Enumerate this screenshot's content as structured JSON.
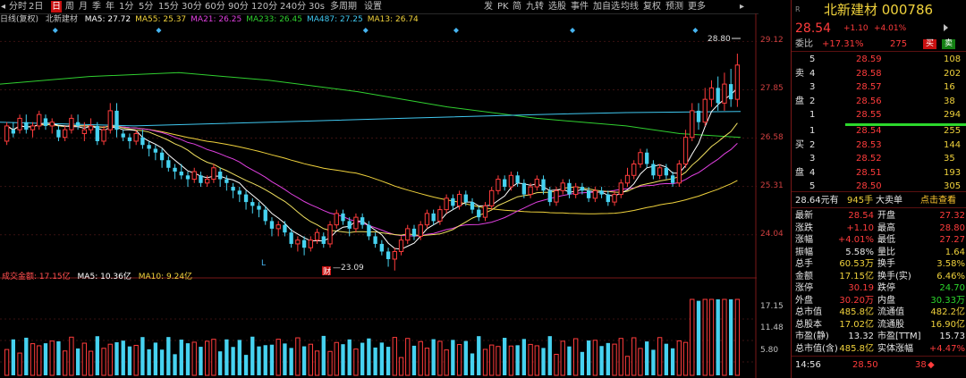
{
  "toolbar": {
    "left_items": [
      {
        "label": "分时",
        "active": false
      },
      {
        "label": "2日",
        "active": false
      },
      {
        "label": "日",
        "active": true
      },
      {
        "label": "周",
        "active": false
      },
      {
        "label": "月",
        "active": false
      },
      {
        "label": "季",
        "active": false
      },
      {
        "label": "年",
        "active": false
      },
      {
        "label": "1分",
        "active": false
      },
      {
        "label": "5分",
        "active": false
      },
      {
        "label": "15分",
        "active": false
      },
      {
        "label": "30分",
        "active": false
      },
      {
        "label": "60分",
        "active": false
      },
      {
        "label": "90分",
        "active": false
      },
      {
        "label": "120分",
        "active": false
      },
      {
        "label": "240分",
        "active": false
      },
      {
        "label": "30s",
        "active": false
      },
      {
        "label": "多周期",
        "active": false
      },
      {
        "label": "设置",
        "active": false
      }
    ],
    "right_items": [
      "发",
      "PK",
      "简",
      "九转",
      "选股",
      "事件",
      "加自选",
      "均线",
      "复权",
      "预测",
      "更多"
    ]
  },
  "ma_line": {
    "title": "日线(复权)",
    "name": "北新建材",
    "ma": [
      {
        "label": "MA5: 27.72",
        "color": "#ffffff"
      },
      {
        "label": "MA55: 25.37",
        "color": "#f0d23c"
      },
      {
        "label": "MA21: 26.25",
        "color": "#e040e0"
      },
      {
        "label": "MA233: 26.45",
        "color": "#30d030"
      },
      {
        "label": "MA487: 27.25",
        "color": "#40c8f0"
      },
      {
        "label": "MA13: 26.74",
        "color": "#f0d23c"
      }
    ]
  },
  "price_axis": [
    "29.12",
    "27.85",
    "26.58",
    "25.31",
    "24.04"
  ],
  "volume_axis": [
    "17.15",
    "11.48",
    "5.80"
  ],
  "annotations": {
    "high": "28.80",
    "low": "23.09",
    "marker_l": "L",
    "marker_cai": "财"
  },
  "volume_line": {
    "title": "成交金额: 17.15亿",
    "ma5": "MA5: 10.36亿",
    "ma10": "MA10: 9.24亿"
  },
  "chart_data": {
    "type": "candlestick",
    "ylim": [
      23.0,
      29.2
    ],
    "candles": [
      [
        26.5,
        26.9,
        26.4,
        27.0
      ],
      [
        26.8,
        26.7,
        26.6,
        27.0
      ],
      [
        26.8,
        27.1,
        26.7,
        27.2
      ],
      [
        27.0,
        26.8,
        26.7,
        27.2
      ],
      [
        26.8,
        26.9,
        26.6,
        27.0
      ],
      [
        26.9,
        27.2,
        26.8,
        27.3
      ],
      [
        27.1,
        26.9,
        26.8,
        27.2
      ],
      [
        26.9,
        27.0,
        26.7,
        27.1
      ],
      [
        26.8,
        26.6,
        26.5,
        26.9
      ],
      [
        26.6,
        26.8,
        26.5,
        26.9
      ],
      [
        26.8,
        27.1,
        26.7,
        27.2
      ],
      [
        27.0,
        26.9,
        26.8,
        27.2
      ],
      [
        26.7,
        26.8,
        26.5,
        27.0
      ],
      [
        26.8,
        26.9,
        26.7,
        27.1
      ],
      [
        26.9,
        26.5,
        26.4,
        27.0
      ],
      [
        26.5,
        26.8,
        26.4,
        26.9
      ],
      [
        26.8,
        27.3,
        26.7,
        27.5
      ],
      [
        27.3,
        26.8,
        26.6,
        27.5
      ],
      [
        26.7,
        26.6,
        26.5,
        26.8
      ],
      [
        26.6,
        26.5,
        26.3,
        26.7
      ],
      [
        26.5,
        26.7,
        26.4,
        26.8
      ],
      [
        26.6,
        26.4,
        26.3,
        26.8
      ],
      [
        26.4,
        26.3,
        26.1,
        26.5
      ],
      [
        26.3,
        26.2,
        26.0,
        26.4
      ],
      [
        26.2,
        26.0,
        25.8,
        26.3
      ],
      [
        26.0,
        25.8,
        25.7,
        26.1
      ],
      [
        25.8,
        25.7,
        25.5,
        25.9
      ],
      [
        25.7,
        25.6,
        25.5,
        25.9
      ],
      [
        25.6,
        25.5,
        25.3,
        25.7
      ],
      [
        25.5,
        25.7,
        25.4,
        25.8
      ],
      [
        25.6,
        25.4,
        25.3,
        25.7
      ],
      [
        25.4,
        25.5,
        25.3,
        25.6
      ],
      [
        25.5,
        25.8,
        25.4,
        25.9
      ],
      [
        25.7,
        25.5,
        25.3,
        25.8
      ],
      [
        25.5,
        25.4,
        25.2,
        25.6
      ],
      [
        25.3,
        25.2,
        25.0,
        25.4
      ],
      [
        25.2,
        25.1,
        24.9,
        25.3
      ],
      [
        25.1,
        24.9,
        24.7,
        25.2
      ],
      [
        24.9,
        24.8,
        24.6,
        25.0
      ],
      [
        24.8,
        24.7,
        24.5,
        24.9
      ],
      [
        24.7,
        24.4,
        24.3,
        24.8
      ],
      [
        24.4,
        24.2,
        24.0,
        24.5
      ],
      [
        24.2,
        24.3,
        24.0,
        24.4
      ],
      [
        24.3,
        24.1,
        24.0,
        24.4
      ],
      [
        24.1,
        23.8,
        23.7,
        24.2
      ],
      [
        23.8,
        23.9,
        23.6,
        24.0
      ],
      [
        23.9,
        23.7,
        23.5,
        24.0
      ],
      [
        23.7,
        23.9,
        23.6,
        24.0
      ],
      [
        23.9,
        24.1,
        23.8,
        24.2
      ],
      [
        24.0,
        23.8,
        23.7,
        24.1
      ],
      [
        23.8,
        24.3,
        23.7,
        24.4
      ],
      [
        24.3,
        24.6,
        24.2,
        24.7
      ],
      [
        24.6,
        24.4,
        24.3,
        24.7
      ],
      [
        24.4,
        24.2,
        24.0,
        24.5
      ],
      [
        24.2,
        24.5,
        24.1,
        24.6
      ],
      [
        24.5,
        24.3,
        24.2,
        24.6
      ],
      [
        24.3,
        24.0,
        23.9,
        24.4
      ],
      [
        24.0,
        23.8,
        23.7,
        24.1
      ],
      [
        23.8,
        23.6,
        23.5,
        23.9
      ],
      [
        23.6,
        23.4,
        23.2,
        23.7
      ],
      [
        23.4,
        23.6,
        23.1,
        23.7
      ],
      [
        23.6,
        23.9,
        23.5,
        24.0
      ],
      [
        23.9,
        24.2,
        23.8,
        24.3
      ],
      [
        24.2,
        24.0,
        23.9,
        24.3
      ],
      [
        24.0,
        24.3,
        23.9,
        24.4
      ],
      [
        24.3,
        24.6,
        24.2,
        24.7
      ],
      [
        24.6,
        24.4,
        24.3,
        24.7
      ],
      [
        24.4,
        24.7,
        24.3,
        24.8
      ],
      [
        24.7,
        25.0,
        24.6,
        25.1
      ],
      [
        25.0,
        24.8,
        24.7,
        25.1
      ],
      [
        24.8,
        25.1,
        24.7,
        25.2
      ],
      [
        25.1,
        24.9,
        24.8,
        25.2
      ],
      [
        24.9,
        24.7,
        24.6,
        25.0
      ],
      [
        24.7,
        24.5,
        24.4,
        24.8
      ],
      [
        24.5,
        24.8,
        24.4,
        24.9
      ],
      [
        24.8,
        25.2,
        24.7,
        25.3
      ],
      [
        25.2,
        25.5,
        25.1,
        25.6
      ],
      [
        25.5,
        25.3,
        25.2,
        25.6
      ],
      [
        25.3,
        25.6,
        25.2,
        25.7
      ],
      [
        25.6,
        25.4,
        25.3,
        25.7
      ],
      [
        25.4,
        25.1,
        25.0,
        25.5
      ],
      [
        25.1,
        25.3,
        25.0,
        25.4
      ],
      [
        25.3,
        25.5,
        25.2,
        25.6
      ],
      [
        25.5,
        25.2,
        25.1,
        25.6
      ],
      [
        25.2,
        24.9,
        24.8,
        25.3
      ],
      [
        24.9,
        25.2,
        24.8,
        25.3
      ],
      [
        25.2,
        25.4,
        25.1,
        25.5
      ],
      [
        25.4,
        25.1,
        25.0,
        25.5
      ],
      [
        25.1,
        25.3,
        25.0,
        25.4
      ],
      [
        25.3,
        25.2,
        25.1,
        25.4
      ],
      [
        25.2,
        25.0,
        24.9,
        25.3
      ],
      [
        25.0,
        25.2,
        24.9,
        25.3
      ],
      [
        25.2,
        25.1,
        25.0,
        25.3
      ],
      [
        25.1,
        24.9,
        24.8,
        25.2
      ],
      [
        24.9,
        25.1,
        24.8,
        25.2
      ],
      [
        25.1,
        25.4,
        25.0,
        25.5
      ],
      [
        25.4,
        25.6,
        25.3,
        25.8
      ],
      [
        25.6,
        25.9,
        25.5,
        26.0
      ],
      [
        25.9,
        26.2,
        25.8,
        26.3
      ],
      [
        26.2,
        25.9,
        25.8,
        26.3
      ],
      [
        25.9,
        25.6,
        25.5,
        26.0
      ],
      [
        25.6,
        25.8,
        25.5,
        25.9
      ],
      [
        25.8,
        25.6,
        25.5,
        25.9
      ],
      [
        25.6,
        25.4,
        25.3,
        25.7
      ],
      [
        25.4,
        25.9,
        25.3,
        26.0
      ],
      [
        25.9,
        26.6,
        25.8,
        26.8
      ],
      [
        26.6,
        27.3,
        26.5,
        27.5
      ],
      [
        27.3,
        27.0,
        26.8,
        27.5
      ],
      [
        27.0,
        27.6,
        26.9,
        27.9
      ],
      [
        27.6,
        27.9,
        27.4,
        28.1
      ],
      [
        27.9,
        27.5,
        27.3,
        28.2
      ],
      [
        27.5,
        28.0,
        27.3,
        28.3
      ],
      [
        28.0,
        27.6,
        27.4,
        28.4
      ],
      [
        27.6,
        28.5,
        27.4,
        28.8
      ]
    ]
  },
  "quote": {
    "code_name": "北新建材 000786",
    "price": "28.54",
    "change": "+1.10",
    "change_pct": "+4.01%",
    "weibi_label": "委比",
    "weibi_val": "+17.31%",
    "weicha": "275",
    "buy_btn": "买",
    "sell_btn": "卖",
    "sell_levels": [
      {
        "lv": "5",
        "price": "28.59",
        "vol": "108"
      },
      {
        "lv": "4",
        "price": "28.58",
        "vol": "202"
      },
      {
        "lv": "3",
        "price": "28.57",
        "vol": "16"
      },
      {
        "lv": "2",
        "price": "28.56",
        "vol": "38"
      },
      {
        "lv": "1",
        "price": "28.55",
        "vol": "294"
      }
    ],
    "buy_levels": [
      {
        "lv": "1",
        "price": "28.54",
        "vol": "255"
      },
      {
        "lv": "2",
        "price": "28.53",
        "vol": "144"
      },
      {
        "lv": "3",
        "price": "28.52",
        "vol": "35"
      },
      {
        "lv": "4",
        "price": "28.51",
        "vol": "193"
      },
      {
        "lv": "5",
        "price": "28.50",
        "vol": "305"
      }
    ],
    "sell_side_char1": "卖",
    "sell_side_char2": "盘",
    "buy_side_char1": "买",
    "buy_side_char2": "盘",
    "bigorder_price": "28.64元有",
    "bigorder_vol": "945手",
    "bigorder_text": "大卖单",
    "bigorder_link": "点击查看",
    "stats": [
      {
        "l1": "最新",
        "v1": "28.54",
        "c1": "red",
        "l2": "开盘",
        "v2": "27.32",
        "c2": "red"
      },
      {
        "l1": "涨跌",
        "v1": "+1.10",
        "c1": "red",
        "l2": "最高",
        "v2": "28.80",
        "c2": "red"
      },
      {
        "l1": "涨幅",
        "v1": "+4.01%",
        "c1": "red",
        "l2": "最低",
        "v2": "27.27",
        "c2": "red"
      },
      {
        "l1": "振幅",
        "v1": "5.58%",
        "c1": "white",
        "l2": "量比",
        "v2": "1.64",
        "c2": "yellow"
      },
      {
        "l1": "总手",
        "v1": "60.53万",
        "c1": "yellow",
        "l2": "换手",
        "v2": "3.58%",
        "c2": "yellow"
      },
      {
        "l1": "金额",
        "v1": "17.15亿",
        "c1": "yellow",
        "l2": "换手(实)",
        "v2": "6.46%",
        "c2": "yellow"
      },
      {
        "l1": "涨停",
        "v1": "30.19",
        "c1": "red",
        "l2": "跌停",
        "v2": "24.70",
        "c2": "green"
      },
      {
        "l1": "外盘",
        "v1": "30.20万",
        "c1": "red",
        "l2": "内盘",
        "v2": "30.33万",
        "c2": "green"
      },
      {
        "l1": "总市值",
        "v1": "485.8亿",
        "c1": "yellow",
        "l2": "流通值",
        "v2": "482.2亿",
        "c2": "yellow"
      },
      {
        "l1": "总股本",
        "v1": "17.02亿",
        "c1": "yellow",
        "l2": "流通股",
        "v2": "16.90亿",
        "c2": "yellow"
      },
      {
        "l1": "市盈(静)",
        "v1": "13.32",
        "c1": "white",
        "l2": "市盈[TTM]",
        "v2": "15.73",
        "c2": "white"
      },
      {
        "l1": "总市值(含)",
        "v1": "485.8亿",
        "c1": "yellow",
        "l2": "实体涨幅",
        "v2": "+4.47%",
        "c2": "red"
      }
    ],
    "tick": {
      "time": "14:56",
      "price": "28.50",
      "vol": "38"
    }
  }
}
